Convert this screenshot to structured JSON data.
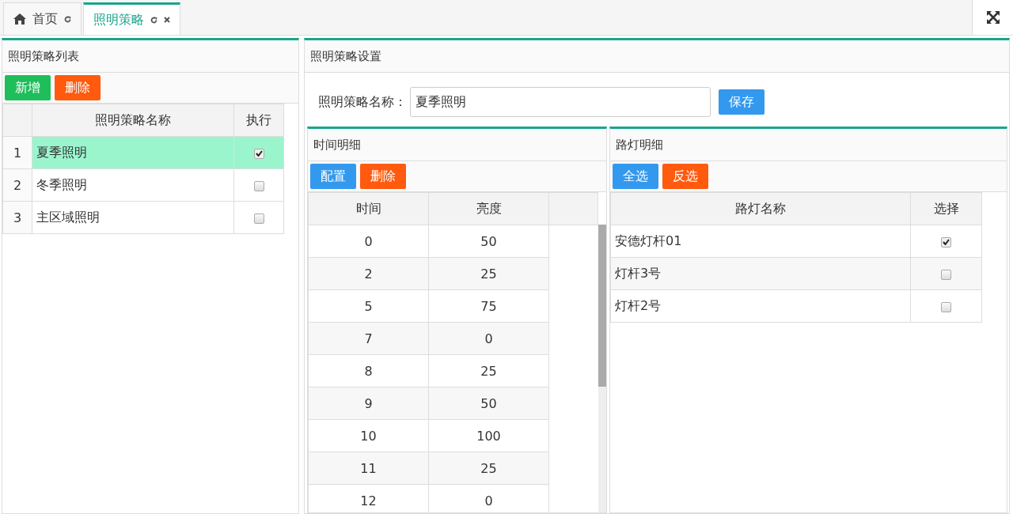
{
  "tabs": [
    {
      "label": "首页",
      "selected": false,
      "closable": false,
      "home": true
    },
    {
      "label": "照明策略",
      "selected": true,
      "closable": true,
      "home": false
    }
  ],
  "strategy_list": {
    "title": "照明策略列表",
    "buttons": [
      {
        "label": "新增",
        "kind": "success"
      },
      {
        "label": "删除",
        "kind": "danger"
      }
    ],
    "columns": [
      "照明策略名称",
      "执行"
    ],
    "rows": [
      {
        "index": "1",
        "name": "夏季照明",
        "selected": true,
        "checked": true
      },
      {
        "index": "2",
        "name": "冬季照明",
        "selected": false,
        "checked": false
      },
      {
        "index": "3",
        "name": "主区域照明",
        "selected": false,
        "checked": false
      }
    ]
  },
  "strategy_settings": {
    "title": "照明策略设置",
    "name_label": "照明策略名称：",
    "name_value": "夏季照明",
    "save_button": "保存"
  },
  "time_detail": {
    "title": "时间明细",
    "buttons": [
      {
        "label": "配置",
        "kind": "primary"
      },
      {
        "label": "删除",
        "kind": "danger"
      }
    ],
    "columns": [
      "时间",
      "亮度"
    ],
    "rows": [
      {
        "time": "0",
        "brightness": "50"
      },
      {
        "time": "2",
        "brightness": "25"
      },
      {
        "time": "5",
        "brightness": "75"
      },
      {
        "time": "7",
        "brightness": "0"
      },
      {
        "time": "8",
        "brightness": "25"
      },
      {
        "time": "9",
        "brightness": "50"
      },
      {
        "time": "10",
        "brightness": "100"
      },
      {
        "time": "11",
        "brightness": "25"
      },
      {
        "time": "12",
        "brightness": "0"
      }
    ]
  },
  "lamp_detail": {
    "title": "路灯明细",
    "buttons": [
      {
        "label": "全选",
        "kind": "primary"
      },
      {
        "label": "反选",
        "kind": "danger"
      }
    ],
    "columns": [
      "路灯名称",
      "选择"
    ],
    "rows": [
      {
        "name": "安德灯杆01",
        "checked": true
      },
      {
        "name": "灯杆3号",
        "checked": false
      },
      {
        "name": "灯杆2号",
        "checked": false
      }
    ]
  }
}
